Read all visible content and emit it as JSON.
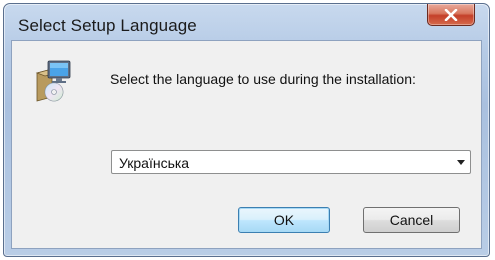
{
  "window": {
    "title": "Select Setup Language",
    "close_symbol": "x"
  },
  "dialog": {
    "prompt": "Select the language to use during the installation:",
    "language_select": {
      "value": "Українська"
    },
    "ok_label": "OK",
    "cancel_label": "Cancel"
  },
  "icons": {
    "setup": "setup-computer-icon",
    "close": "close-icon",
    "dropdown": "chevron-down-icon"
  },
  "colors": {
    "close_button": "#d0553d",
    "ok_border": "#3c7fb1",
    "title_bar": "#b6cbe6"
  }
}
